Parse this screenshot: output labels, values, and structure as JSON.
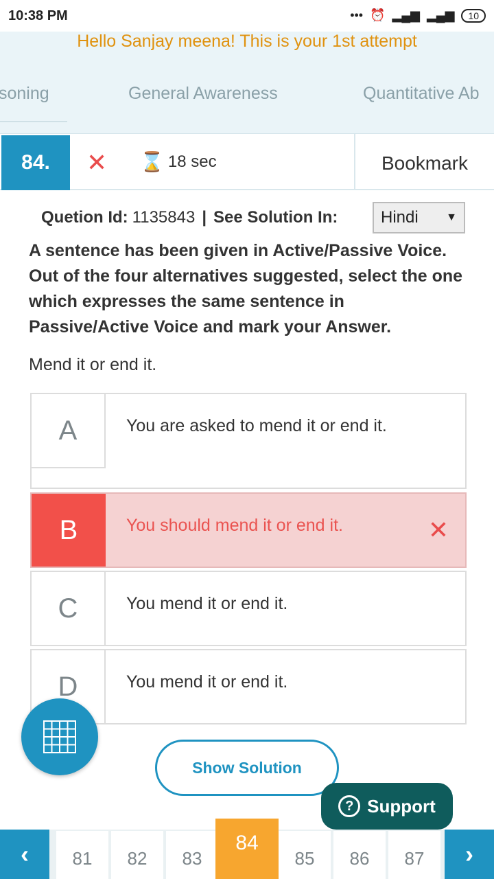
{
  "status_bar": {
    "time": "10:38 PM",
    "battery": "10"
  },
  "greeting": "Hello Sanjay meena! This is your 1st attempt",
  "tabs": [
    "soning",
    "General Awareness",
    "Quantitative Ab"
  ],
  "question_bar": {
    "number": "84.",
    "timer": "18 sec",
    "bookmark_label": "Bookmark"
  },
  "meta": {
    "id_label": "Quetion Id:",
    "id_value": "1135843",
    "separator": "|",
    "solution_label": "See Solution In:",
    "language": "Hindi"
  },
  "question_text": "A sentence has been given in Active/Passive Voice. Out of the four alternatives suggested, select the one which expresses the same sentence in Passive/Active Voice and mark your Answer.",
  "sentence": "Mend it or end it.",
  "options": [
    {
      "letter": "A",
      "text": "You are asked to mend it or end it."
    },
    {
      "letter": "B",
      "text": "You should mend it or end it.",
      "state": "wrong"
    },
    {
      "letter": "C",
      "text": "You mend it or end it."
    },
    {
      "letter": "D",
      "text": "You mend it or end it."
    }
  ],
  "show_solution_label": "Show Solution",
  "support_label": "Support",
  "pager": {
    "pages": [
      "81",
      "82",
      "83",
      "84",
      "85",
      "86",
      "87"
    ],
    "current": "84"
  },
  "colors": {
    "accent": "#1f93c1",
    "wrong": "#f2504a",
    "current_page": "#f7a62f",
    "greeting": "#e0920f"
  }
}
